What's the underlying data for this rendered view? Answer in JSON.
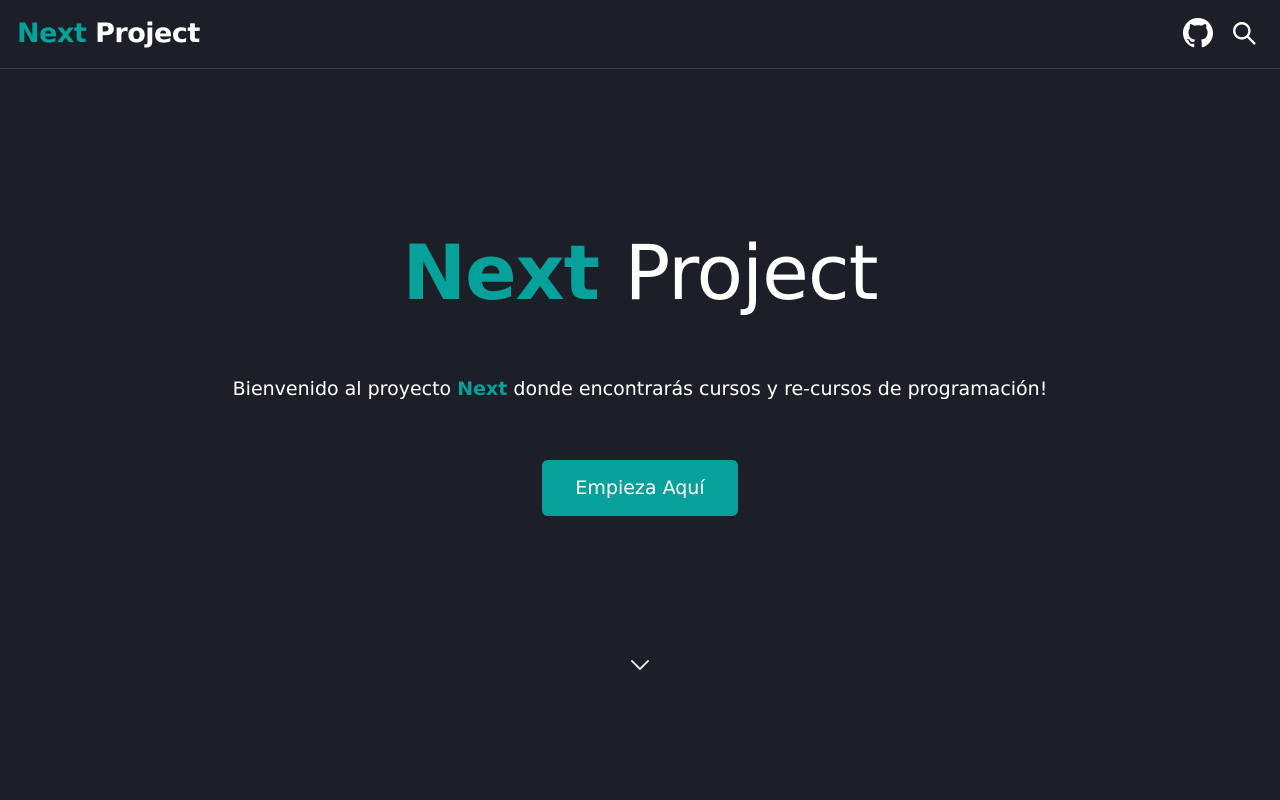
{
  "navbar": {
    "brand_accent": "Next",
    "brand_rest": "Project",
    "github_icon": "github-icon",
    "search_icon": "search-icon"
  },
  "hero": {
    "title_accent": "Next",
    "title_rest": "Project",
    "tagline_before": "Bienvenido al proyecto ",
    "tagline_accent": "Next",
    "tagline_after": " donde encontrarás cursos y re-cursos de programación!",
    "cta_label": "Empieza Aquí",
    "scroll_icon": "chevron-down-icon"
  },
  "colors": {
    "background": "#1c1f27",
    "accent": "#05a19a",
    "text": "#ffffff",
    "divider": "#3a3e48"
  }
}
